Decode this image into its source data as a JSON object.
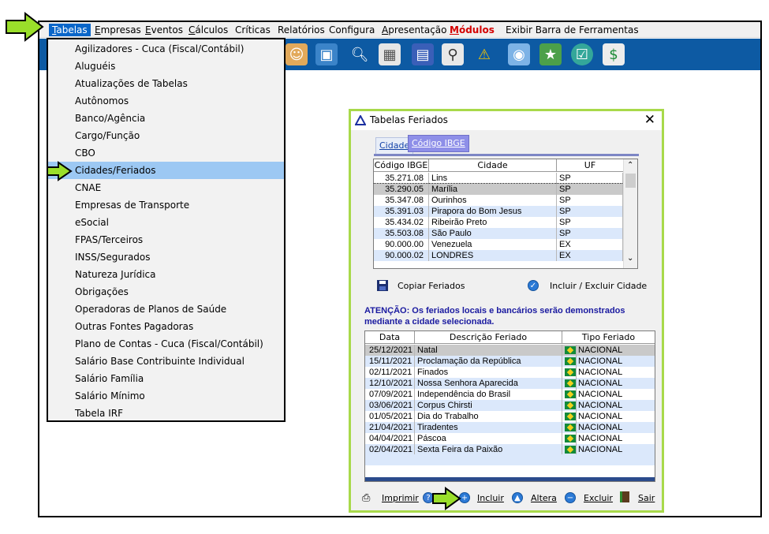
{
  "menubar": {
    "items": [
      "Tabelas",
      "Empresas",
      "Eventos",
      "Cálculos",
      "Críticas",
      "Relatórios",
      "Configura",
      "Apresentação",
      "Módulos",
      "Exibir Barra de Ferramentas"
    ]
  },
  "dropdown": {
    "items": [
      "Agilizadores - Cuca (Fiscal/Contábil)",
      "Aluguéis",
      "Atualizações de Tabelas",
      "Autônomos",
      "Banco/Agência",
      "Cargo/Função",
      "CBO",
      "Cidades/Feriados",
      "CNAE",
      "Empresas de Transporte",
      "eSocial",
      "FPAS/Terceiros",
      "INSS/Segurados",
      "Natureza Jurídica",
      "Obrigações",
      "Operadoras de Planos de Saúde",
      "Outras Fontes Pagadoras",
      "Plano de Contas - Cuca (Fiscal/Contábil)",
      "Salário Base Contribuinte Individual",
      "Salário Família",
      "Salário Mínimo",
      "Tabela IRF"
    ],
    "highlighted_index": 7
  },
  "dialog": {
    "title": "Tabelas Feriados",
    "close": "✕",
    "tabs": [
      "Cidade",
      "Código IBGE"
    ],
    "cities": {
      "headers": [
        "Código IBGE",
        "Cidade",
        "UF"
      ],
      "rows": [
        [
          "35.271.08",
          "Lins",
          "SP"
        ],
        [
          "35.290.05",
          "Marília",
          "SP"
        ],
        [
          "35.347.08",
          "Ourinhos",
          "SP"
        ],
        [
          "35.391.03",
          "Pirapora do Bom Jesus",
          "SP"
        ],
        [
          "35.434.02",
          "Ribeirão Preto",
          "SP"
        ],
        [
          "35.503.08",
          "São Paulo",
          "SP"
        ],
        [
          "90.000.00",
          "Venezuela",
          "EX"
        ],
        [
          "90.000.02",
          "LONDRES",
          "EX"
        ]
      ],
      "selected_index": 1
    },
    "copy_holidays": "Copiar Feriados",
    "include_exclude_city": "Incluir / Excluir Cidade",
    "attention_line1": "ATENÇÃO: Os feriados locais e bancários serão demonstrados",
    "attention_line2": "mediante a cidade selecionada.",
    "holidays": {
      "headers": [
        "Data",
        "Descrição Feriado",
        "Tipo Feriado"
      ],
      "rows": [
        [
          "25/12/2021",
          "Natal",
          "NACIONAL"
        ],
        [
          "15/11/2021",
          "Proclamação da República",
          "NACIONAL"
        ],
        [
          "02/11/2021",
          "Finados",
          "NACIONAL"
        ],
        [
          "12/10/2021",
          "Nossa Senhora Aparecida",
          "NACIONAL"
        ],
        [
          "07/09/2021",
          "Independência do Brasil",
          "NACIONAL"
        ],
        [
          "03/06/2021",
          "Corpus Chirsti",
          "NACIONAL"
        ],
        [
          "01/05/2021",
          "Dia do Trabalho",
          "NACIONAL"
        ],
        [
          "21/04/2021",
          "Tiradentes",
          "NACIONAL"
        ],
        [
          "04/04/2021",
          "Páscoa",
          "NACIONAL"
        ],
        [
          "02/04/2021",
          "Sexta Feira da Paixão",
          "NACIONAL"
        ]
      ],
      "selected_index": 0
    },
    "buttons": {
      "print": "Imprimir",
      "help": "?",
      "include": "Incluir",
      "edit": "Altera",
      "delete": "Excluir",
      "exit": "Sair"
    }
  }
}
